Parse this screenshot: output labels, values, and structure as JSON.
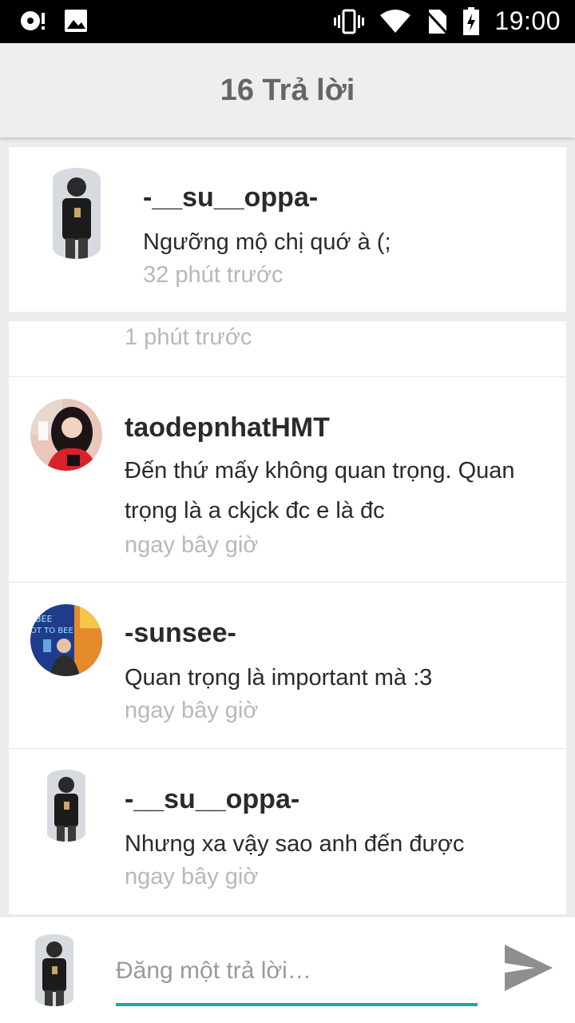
{
  "status_bar": {
    "time": "19:00",
    "icons": [
      "app-notification-icon",
      "image-icon",
      "vibrate-icon",
      "wifi-icon",
      "no-sim-icon",
      "battery-charging-icon"
    ]
  },
  "app_bar": {
    "title": "16 Trả lời"
  },
  "parent_comment": {
    "user": "-__su__oppa-",
    "text": "Ngưỡng mộ chị quớ à (;",
    "time": "32 phút trước"
  },
  "thread": {
    "partial_time": "1 phút trước",
    "replies": [
      {
        "user": "taodepnhatHMT",
        "text": "Đến thứ mấy không quan trọng. Quan trọng là a ckjck đc e là đc",
        "time": "ngay bây giờ"
      },
      {
        "user": "-sunsee-",
        "text": "Quan trọng là important mà :3",
        "time": "ngay bây giờ"
      },
      {
        "user": "-__su__oppa-",
        "text": "Nhưng xa vậy sao anh đến được",
        "time": "ngay bây giờ"
      }
    ]
  },
  "composer": {
    "placeholder": "Đăng một trả lời…",
    "value": ""
  },
  "colors": {
    "accent": "#1aa6b0",
    "muted_text": "#b8b8b8",
    "send_icon": "#8e8e8e"
  }
}
